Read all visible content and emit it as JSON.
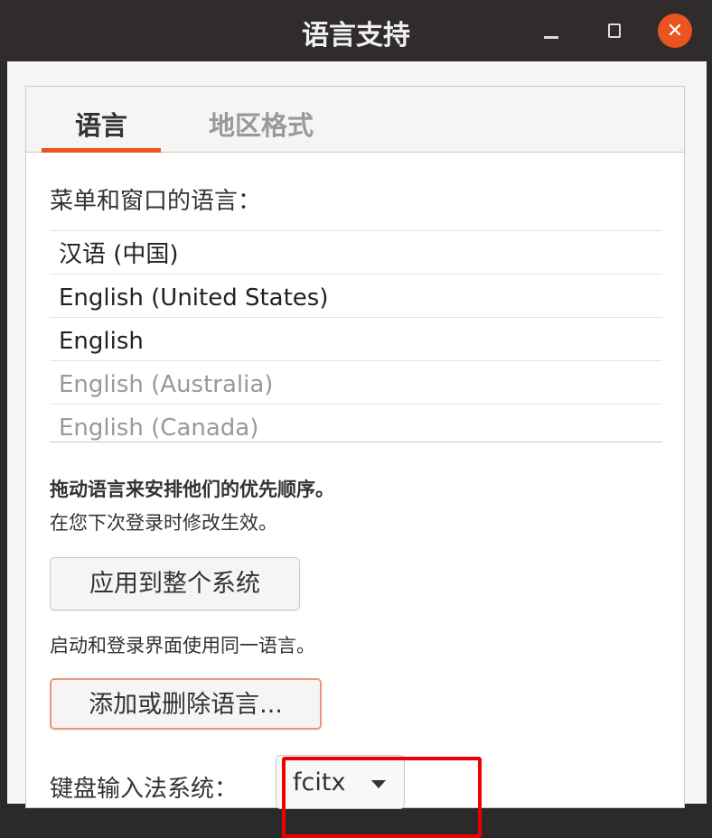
{
  "window": {
    "title": "语言支持"
  },
  "tabs": [
    {
      "label": "语言"
    },
    {
      "label": "地区格式"
    }
  ],
  "language_section": {
    "label": "菜单和窗口的语言：",
    "languages": [
      "汉语 (中国)",
      "English (United States)",
      "English",
      "English (Australia)",
      "English (Canada)"
    ],
    "hint_bold": "拖动语言来安排他们的优先顺序。",
    "hint": "在您下次登录时修改生效。",
    "apply_button": "应用到整个系统",
    "apply_hint": "启动和登录界面使用同一语言。",
    "add_remove_button": "添加或删除语言...",
    "input_method_label": "键盘输入法系统：",
    "input_method_value": "fcitx"
  },
  "colors": {
    "accent": "#e95420",
    "highlight": "#e00000"
  }
}
